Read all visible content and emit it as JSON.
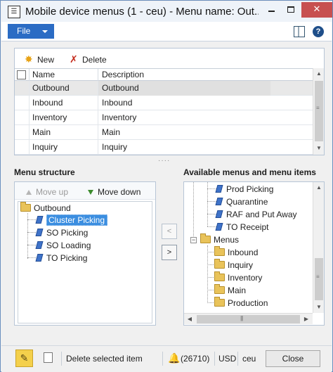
{
  "window": {
    "title": "Mobile device menus (1 - ceu) - Menu name: Out...",
    "icon_glyph": "☰"
  },
  "menubar": {
    "file_label": "File"
  },
  "grid_toolbar": {
    "new_label": "New",
    "delete_label": "Delete"
  },
  "grid": {
    "columns": [
      "Name",
      "Description"
    ],
    "rows": [
      {
        "name": "Outbound",
        "description": "Outbound",
        "selected": true
      },
      {
        "name": "Inbound",
        "description": "Inbound"
      },
      {
        "name": "Inventory",
        "description": "Inventory"
      },
      {
        "name": "Main",
        "description": "Main"
      },
      {
        "name": "Inquiry",
        "description": "Inquiry"
      }
    ]
  },
  "menu_structure": {
    "title": "Menu structure",
    "move_up_label": "Move up",
    "move_down_label": "Move down",
    "root": "Outbound",
    "items": [
      "Cluster Picking",
      "SO Picking",
      "SO Loading",
      "TO Picking"
    ],
    "selected_item": "Cluster Picking"
  },
  "transfer": {
    "remove_glyph": "<",
    "add_glyph": ">"
  },
  "available": {
    "title": "Available menus and menu items",
    "items": [
      "Prod Picking",
      "Quarantine",
      "RAF and Put Away",
      "TO Receipt"
    ],
    "menus_folder": "Menus",
    "menu_folders": [
      "Inbound",
      "Inquiry",
      "Inventory",
      "Main",
      "Production"
    ]
  },
  "statusbar": {
    "message": "Delete selected item",
    "notifications": "(26710)",
    "currency": "USD",
    "company": "ceu",
    "close_label": "Close"
  },
  "colors": {
    "accent": "#2b6cc4",
    "selection": "#3b8ee0",
    "close_button": "#c75050"
  }
}
